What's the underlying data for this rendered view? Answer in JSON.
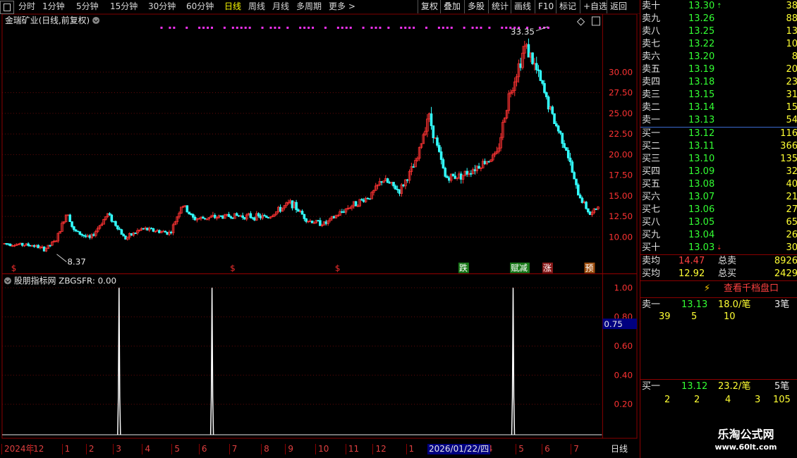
{
  "toolbar": {
    "periods": [
      "分时",
      "1分钟",
      "5分钟",
      "15分钟",
      "30分钟",
      "60分钟",
      "日线",
      "周线",
      "月线",
      "多周期",
      "更多 >"
    ],
    "active": "日线",
    "actions": [
      "复权",
      "叠加",
      "多股",
      "统计",
      "画线",
      "F10",
      "标记",
      "+自选",
      "返回"
    ]
  },
  "chart": {
    "title": "金瑞矿业(日线,前复权)",
    "high_label": "33.35",
    "low_label": "8.37",
    "price_axis": [
      "30.00",
      "27.50",
      "25.00",
      "22.50",
      "20.00",
      "17.50",
      "15.00",
      "12.50",
      "10.00"
    ],
    "markers": [
      {
        "text": "$",
        "pos": 0.015,
        "color": "#ff3030",
        "boxed": false
      },
      {
        "text": "$",
        "pos": 0.38,
        "color": "#ff3030",
        "boxed": false
      },
      {
        "text": "$",
        "pos": 0.555,
        "color": "#ff3030",
        "boxed": false
      },
      {
        "text": "跌",
        "pos": 0.762,
        "color": "#ffffff",
        "boxed": true,
        "bg": "#1a7a1a"
      },
      {
        "text": "赋减",
        "pos": 0.848,
        "color": "#ffffff",
        "boxed": true,
        "bg": "#1a7a1a"
      },
      {
        "text": "涨",
        "pos": 0.902,
        "color": "#ffffff",
        "boxed": true,
        "bg": "#8a1a1a"
      },
      {
        "text": "预",
        "pos": 0.972,
        "color": "#ffffff",
        "boxed": true,
        "bg": "#a05010"
      }
    ],
    "indicator_title": "股朋指标网  ZBGSFR: 0.00",
    "indicator_axis": [
      "1.00",
      "0.80",
      "0.60",
      "0.40",
      "0.20"
    ],
    "indicator_highlight": "0.75",
    "indicator_spikes": [
      0.195,
      0.35,
      0.852
    ],
    "dates": [
      {
        "text": "2024年",
        "pos": 0.0
      },
      {
        "text": "12",
        "pos": 0.048
      },
      {
        "text": "1",
        "pos": 0.1
      },
      {
        "text": "2",
        "pos": 0.14
      },
      {
        "text": "3",
        "pos": 0.185
      },
      {
        "text": "4",
        "pos": 0.233
      },
      {
        "text": "5",
        "pos": 0.282
      },
      {
        "text": "6",
        "pos": 0.327
      },
      {
        "text": "7",
        "pos": 0.377
      },
      {
        "text": "8",
        "pos": 0.43
      },
      {
        "text": "9",
        "pos": 0.47
      },
      {
        "text": "10",
        "pos": 0.52
      },
      {
        "text": "11",
        "pos": 0.57
      },
      {
        "text": "12",
        "pos": 0.615
      },
      {
        "text": "1",
        "pos": 0.67
      },
      {
        "text": "4",
        "pos": 0.8
      },
      {
        "text": "5",
        "pos": 0.852
      },
      {
        "text": "6",
        "pos": 0.895
      },
      {
        "text": "7",
        "pos": 0.943
      }
    ],
    "date_highlight": "2026/01/22/四",
    "period_label": "日线"
  },
  "orderbook": {
    "asks": [
      {
        "label": "卖十",
        "price": "13.30",
        "vol": "38",
        "mark": "up"
      },
      {
        "label": "卖九",
        "price": "13.26",
        "vol": "88"
      },
      {
        "label": "卖八",
        "price": "13.25",
        "vol": "13"
      },
      {
        "label": "卖七",
        "price": "13.22",
        "vol": "10"
      },
      {
        "label": "卖六",
        "price": "13.20",
        "vol": "8"
      },
      {
        "label": "卖五",
        "price": "13.19",
        "vol": "20"
      },
      {
        "label": "卖四",
        "price": "13.18",
        "vol": "23"
      },
      {
        "label": "卖三",
        "price": "13.15",
        "vol": "31"
      },
      {
        "label": "卖二",
        "price": "13.14",
        "vol": "15"
      },
      {
        "label": "卖一",
        "price": "13.13",
        "vol": "54"
      }
    ],
    "bids": [
      {
        "label": "买一",
        "price": "13.12",
        "vol": "116"
      },
      {
        "label": "买二",
        "price": "13.11",
        "vol": "366"
      },
      {
        "label": "买三",
        "price": "13.10",
        "vol": "135"
      },
      {
        "label": "买四",
        "price": "13.09",
        "vol": "32"
      },
      {
        "label": "买五",
        "price": "13.08",
        "vol": "40"
      },
      {
        "label": "买六",
        "price": "13.07",
        "vol": "21"
      },
      {
        "label": "买七",
        "price": "13.06",
        "vol": "27"
      },
      {
        "label": "买八",
        "price": "13.05",
        "vol": "65"
      },
      {
        "label": "买九",
        "price": "13.04",
        "vol": "26"
      },
      {
        "label": "买十",
        "price": "13.03",
        "vol": "30",
        "mark": "down"
      }
    ],
    "avg_ask_label": "卖均",
    "avg_ask": "14.47",
    "total_ask_label": "总卖",
    "total_ask": "8926",
    "avg_bid_label": "买均",
    "avg_bid": "12.92",
    "total_bid_label": "总买",
    "total_bid": "2429",
    "thousand_button": "查看千档盘口",
    "ask1": {
      "label": "卖一",
      "price": "13.13",
      "per": "18.0/笔",
      "count": "3笔",
      "queue": [
        "39",
        "5",
        "10"
      ]
    },
    "bid1": {
      "label": "买一",
      "price": "13.12",
      "per": "23.2/笔",
      "count": "5笔",
      "queue": [
        "2",
        "2",
        "4",
        "3",
        "105"
      ]
    }
  },
  "watermark": {
    "line1": "乐淘公式网",
    "line2": "www.60lt.com"
  },
  "colors": {
    "up": "#ff3333",
    "down": "#33ffff",
    "grid": "#7a1010",
    "accent": "#ff33ff"
  }
}
